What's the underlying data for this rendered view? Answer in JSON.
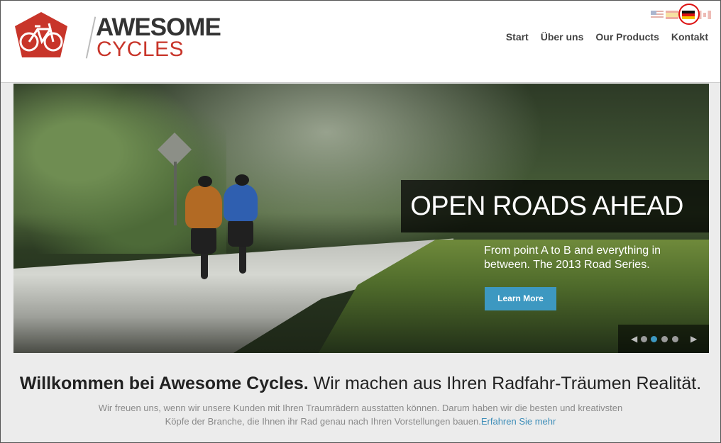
{
  "header": {
    "logo": {
      "word1": "AWESOME",
      "word2": "CYCLES",
      "brand_color": "#c8352a"
    },
    "languages": [
      {
        "code": "us",
        "icon": "us-flag-icon"
      },
      {
        "code": "es",
        "icon": "spain-flag-icon"
      },
      {
        "code": "de",
        "icon": "germany-flag-icon",
        "selected": true
      },
      {
        "code": "ca",
        "icon": "canada-flag-icon"
      }
    ],
    "nav": [
      "Start",
      "Über uns",
      "Our Products",
      "Kontakt"
    ]
  },
  "hero": {
    "title": "OPEN ROADS AHEAD",
    "text": "From point A to B and everything in between. The 2013 Road Series.",
    "button_label": "Learn More",
    "slides_count": 4,
    "active_slide": 2,
    "accent_color": "#3d98c1"
  },
  "welcome": {
    "heading_bold": "Willkommen bei Awesome Cycles.",
    "heading_rest": " Wir machen aus Ihren Radfahr-Träumen Realität.",
    "text_line1": "Wir freuen uns, wenn wir unsere Kunden mit Ihren Traumrädern ausstatten können. Darum haben wir die besten und kreativsten",
    "text_line2": "Köpfe der Branche, die Ihnen ihr Rad genau nach Ihren Vorstellungen bauen.",
    "link_label": "Erfahren Sie mehr"
  }
}
